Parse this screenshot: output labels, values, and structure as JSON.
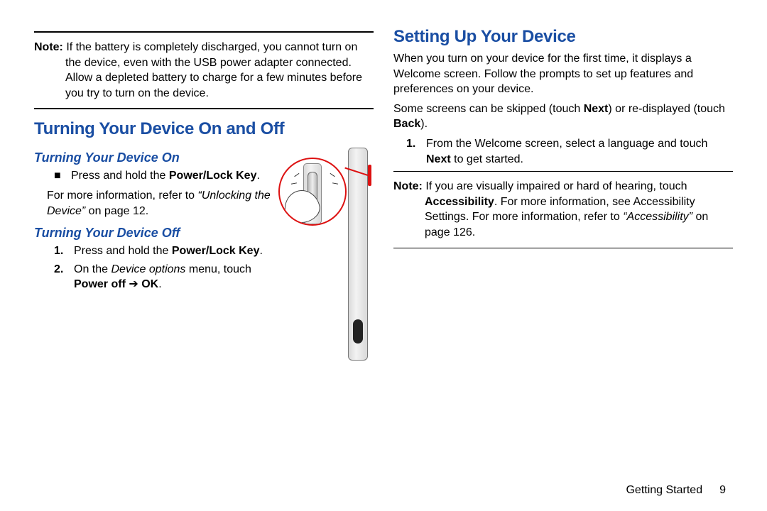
{
  "left": {
    "note_label": "Note:",
    "note_body": "If the battery is completely discharged, you cannot turn on the device, even with the USB power adapter connected. Allow a depleted battery to charge for a few minutes before you try to turn on the device.",
    "h2": "Turning Your Device On and Off",
    "on": {
      "h3": "Turning Your Device On",
      "bullet_pre": "Press and hold the ",
      "bullet_bold": "Power/Lock Key",
      "bullet_post": ".",
      "more_pre": "For more information, refer to ",
      "more_ital": "“Unlocking the Device”",
      "more_post": " on page 12."
    },
    "off": {
      "h3": "Turning Your Device Off",
      "s1_pre": "Press and hold the ",
      "s1_bold": "Power/Lock Key",
      "s1_post": ".",
      "s2_pre": "On the ",
      "s2_ital": "Device options",
      "s2_mid": " menu, touch ",
      "s2_b1": "Power off",
      "s2_arrow": " ➔ ",
      "s2_b2": "OK",
      "s2_post": "."
    }
  },
  "right": {
    "h2": "Setting Up Your Device",
    "p1": "When you turn on your device for the first time, it displays a Welcome screen. Follow the prompts to set up features and preferences on your device.",
    "p2_pre": "Some screens can be skipped (touch ",
    "p2_b1": "Next",
    "p2_mid": ") or re-displayed (touch ",
    "p2_b2": "Back",
    "p2_post": ").",
    "s1_pre": "From the Welcome screen, select a language and touch ",
    "s1_b": "Next",
    "s1_post": " to get started.",
    "note_label": "Note:",
    "note_body_pre": "If you are visually impaired or hard of hearing, touch ",
    "note_body_b": "Accessibility",
    "note_body_mid": ". For more information, see Accessibility Settings. For more information, refer to ",
    "note_body_ital": "“Accessibility”",
    "note_body_post": " on page 126."
  },
  "footer": {
    "section": "Getting Started",
    "page": "9"
  },
  "numbers": {
    "one": "1.",
    "two": "2."
  }
}
